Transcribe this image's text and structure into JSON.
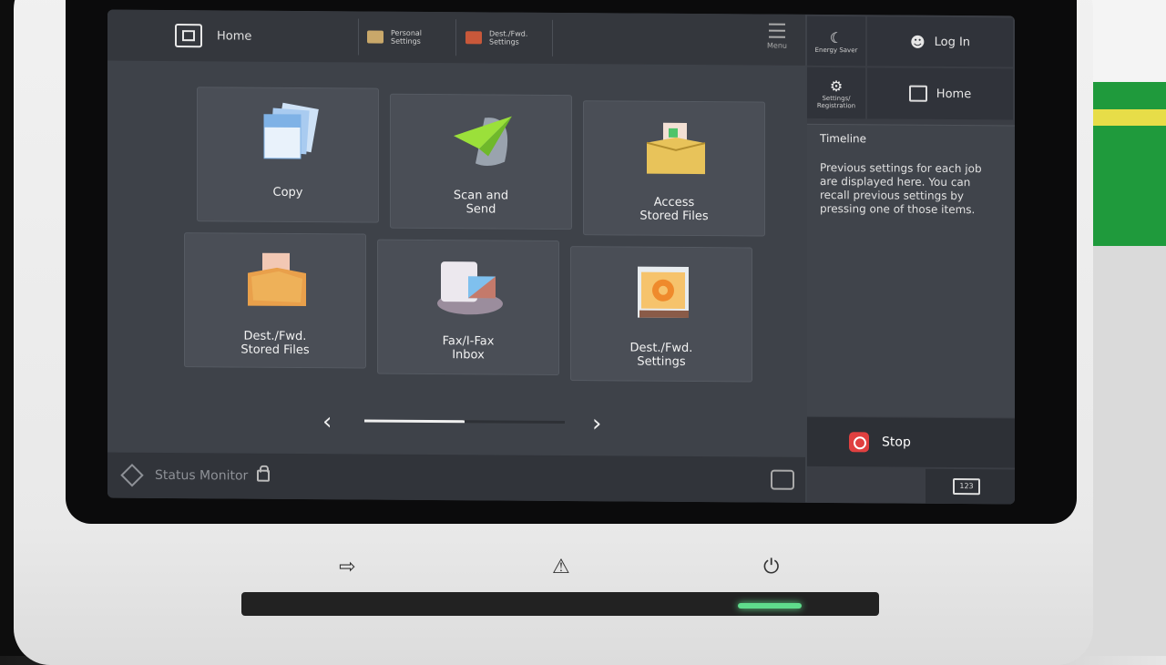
{
  "topbar": {
    "home_label": "Home",
    "personal_settings": [
      "Personal",
      "Settings"
    ],
    "dest_fwd_settings": [
      "Dest./Fwd.",
      "Settings"
    ],
    "menu_label": "Menu"
  },
  "tiles": [
    {
      "label": [
        "Copy"
      ],
      "icon": "copy-icon",
      "color": "#7fb2e6"
    },
    {
      "label": [
        "Scan and",
        "Send"
      ],
      "icon": "paper-plane-icon",
      "color": "#9be03a"
    },
    {
      "label": [
        "Access",
        "Stored Files"
      ],
      "icon": "storage-box-icon",
      "color": "#e8c35a"
    },
    {
      "label": [
        "Dest./Fwd.",
        "Stored Files"
      ],
      "icon": "stored-files-icon",
      "color": "#e9a04b"
    },
    {
      "label": [
        "Fax/I-Fax",
        "Inbox"
      ],
      "icon": "inbox-icon",
      "color": "#e8e3ea"
    },
    {
      "label": [
        "Dest./Fwd.",
        "Settings"
      ],
      "icon": "settings-gear-icon",
      "color": "#ef8a2c"
    }
  ],
  "pager": {
    "progress": 0.5
  },
  "bottombar": {
    "status_monitor": "Status Monitor"
  },
  "rpanel": {
    "energy_saver": [
      "Energy Saver"
    ],
    "login": "Log In",
    "settings_registration": [
      "Settings/",
      "Registration"
    ],
    "home": "Home",
    "timeline_title": "Timeline",
    "timeline_text": "Previous settings for each job are displayed here. You can recall previous settings by pressing one of those items.",
    "stop": "Stop",
    "counter": "123"
  }
}
